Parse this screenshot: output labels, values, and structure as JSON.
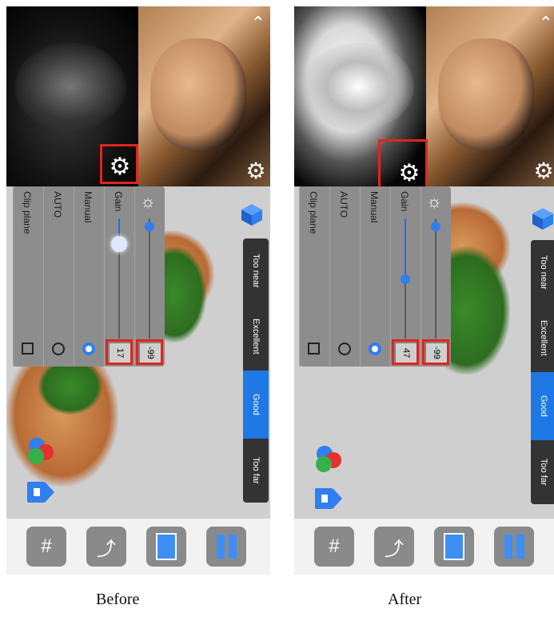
{
  "panels": [
    {
      "caption": "Before",
      "distance": {
        "labels": [
          "Too near",
          "Excellent",
          "Good",
          "Too far"
        ],
        "selected": "Good"
      },
      "settings": {
        "exposure_value": "-99",
        "gain_label": "Gain",
        "gain_value": "17",
        "manual_label": "Manual",
        "auto_label": "AUTO",
        "clip_label": "Clip plane",
        "mode_selected": "Manual"
      }
    },
    {
      "caption": "After",
      "distance": {
        "labels": [
          "Too near",
          "Excellent",
          "Good",
          "Too far"
        ],
        "selected": "Good"
      },
      "settings": {
        "exposure_value": "-99",
        "gain_label": "Gain",
        "gain_value": "47",
        "manual_label": "Manual",
        "auto_label": "AUTO",
        "clip_label": "Clip plane",
        "mode_selected": "Manual"
      }
    }
  ],
  "icons": {
    "settings": "gear-icon",
    "collapse": "chevron-up-icon",
    "exposure": "sun-icon",
    "view_cube": "cube-icon",
    "color": "color-circles-icon",
    "home": "home-icon",
    "grid": "grid-icon",
    "undo": "undo-arrow-icon",
    "single_view": "square-icon",
    "menu": "two-bars-icon"
  },
  "colors": {
    "highlight": "#e0241f",
    "accent": "#1e78e6"
  }
}
